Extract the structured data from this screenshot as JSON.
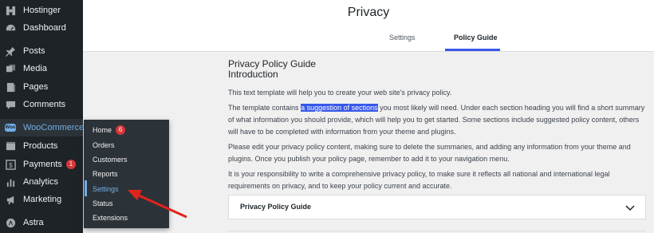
{
  "sidebar": {
    "items": [
      {
        "label": "Hostinger",
        "icon": "hostinger-icon"
      },
      {
        "label": "Dashboard",
        "icon": "dashboard-icon"
      },
      {
        "label": "Posts",
        "icon": "pin-icon"
      },
      {
        "label": "Media",
        "icon": "media-icon"
      },
      {
        "label": "Pages",
        "icon": "page-icon"
      },
      {
        "label": "Comments",
        "icon": "comment-icon"
      },
      {
        "label": "WooCommerce",
        "icon": "woo-icon"
      },
      {
        "label": "Products",
        "icon": "products-icon"
      },
      {
        "label": "Payments",
        "icon": "dollar-icon",
        "badge": "1"
      },
      {
        "label": "Analytics",
        "icon": "analytics-icon"
      },
      {
        "label": "Marketing",
        "icon": "megaphone-icon"
      },
      {
        "label": "Astra",
        "icon": "astra-icon"
      }
    ],
    "woo_icon_text": "Woo"
  },
  "submenu": {
    "items": [
      {
        "label": "Home",
        "badge": "6"
      },
      {
        "label": "Orders"
      },
      {
        "label": "Customers"
      },
      {
        "label": "Reports"
      },
      {
        "label": "Settings"
      },
      {
        "label": "Status"
      },
      {
        "label": "Extensions"
      }
    ]
  },
  "header": {
    "title": "Privacy",
    "tabs": [
      {
        "label": "Settings"
      },
      {
        "label": "Policy Guide"
      }
    ],
    "active_tab": "Policy Guide"
  },
  "main": {
    "title_line1": "Privacy Policy Guide",
    "title_line2": "Introduction",
    "p1": "This text template will help you to create your web site’s privacy policy.",
    "p2_pre": "The template contains ",
    "p2_highlight": "a suggestion of sections",
    "p2_post": " you most likely will need. Under each section heading you will find a short summary of what information you should provide, which will help you to get started. Some sections include suggested policy content, others will have to be completed with information from your theme and plugins.",
    "p3": "Please edit your privacy policy content, making sure to delete the summaries, and adding any information from your theme and plugins. Once you publish your policy page, remember to add it to your navigation menu.",
    "p4": "It is your responsibility to write a comprehensive privacy policy, to make sure it reflects all national and international legal requirements on privacy, and to keep your policy current and accurate.",
    "accordion_label": "Privacy Policy Guide"
  },
  "colors": {
    "sidebar_bg": "#1d2327",
    "accent_blue": "#72aee6",
    "highlight": "#3858e9",
    "badge_red": "#d63638",
    "arrow_red": "#e0231c"
  }
}
